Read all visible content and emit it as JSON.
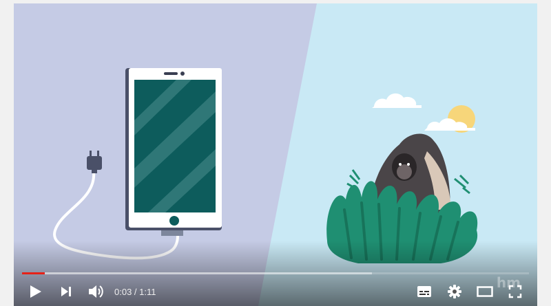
{
  "player": {
    "progress": {
      "played_fraction": 0.045,
      "loaded_fraction": 0.69
    },
    "time": {
      "current": "0:03",
      "separator": " / ",
      "duration": "1:11"
    },
    "watermark": "hm",
    "icons": {
      "play": "play-icon",
      "next": "next-icon",
      "volume": "volume-icon",
      "subtitles": "subtitles-icon",
      "settings": "gear-icon",
      "theater": "theater-mode-icon",
      "fullscreen": "fullscreen-icon"
    },
    "colors": {
      "progress_played": "#e62117",
      "left_panel": "#c5cbe5",
      "right_panel": "#c9e9f5",
      "screen": "#0d5c5c",
      "foliage": "#1f8f72"
    }
  }
}
